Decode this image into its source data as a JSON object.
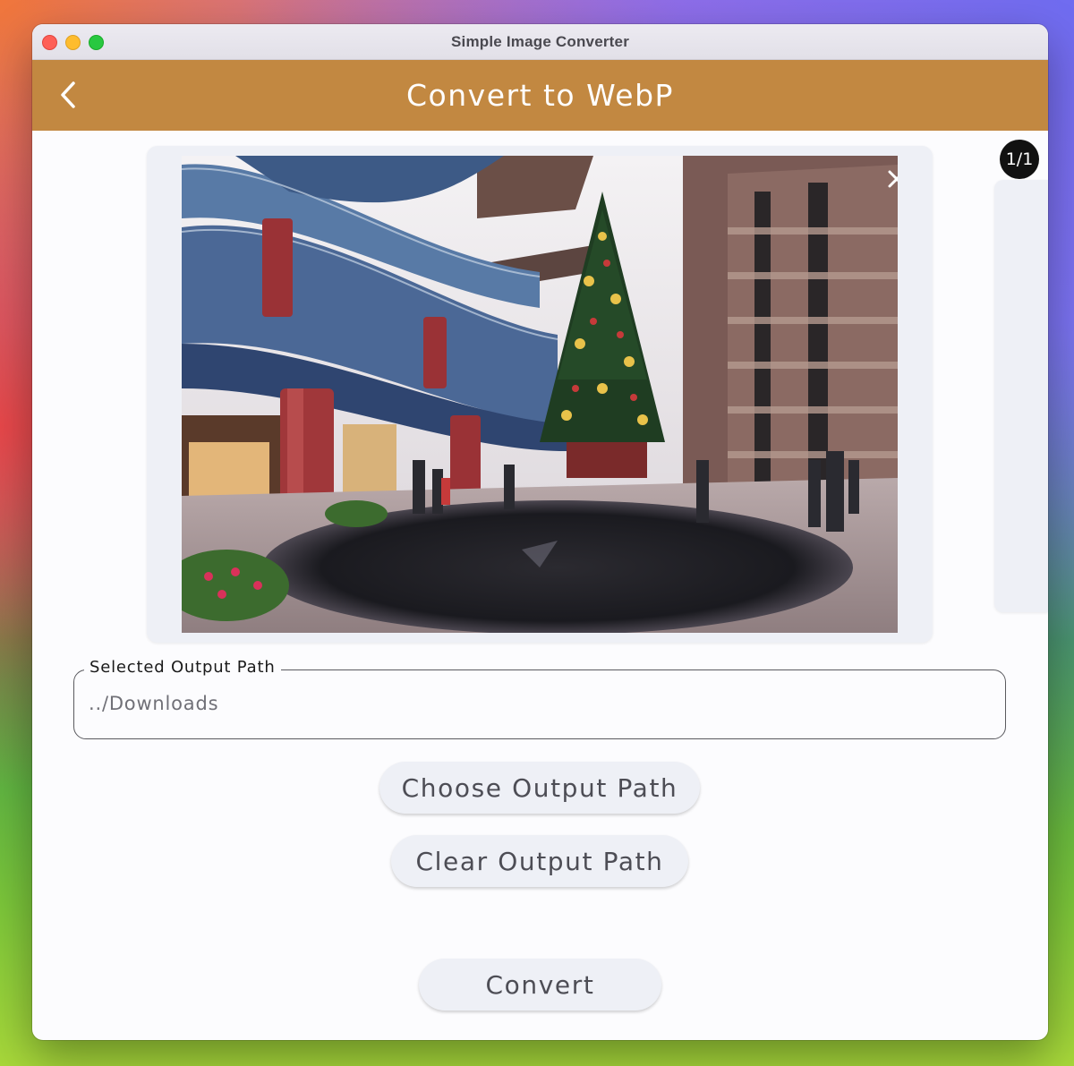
{
  "window": {
    "title": "Simple Image Converter"
  },
  "appbar": {
    "title": "Convert to WebP",
    "back_icon": "chevron-left-icon",
    "background_color": "#c28841"
  },
  "preview": {
    "counter": "1/1",
    "remove_icon": "close-icon",
    "image_description": "indoor atrium with christmas tree"
  },
  "output_path": {
    "label": "Selected Output Path",
    "value": "../Downloads"
  },
  "buttons": {
    "choose_label": "Choose Output Path",
    "clear_label": "Clear Output Path",
    "convert_label": "Convert"
  }
}
